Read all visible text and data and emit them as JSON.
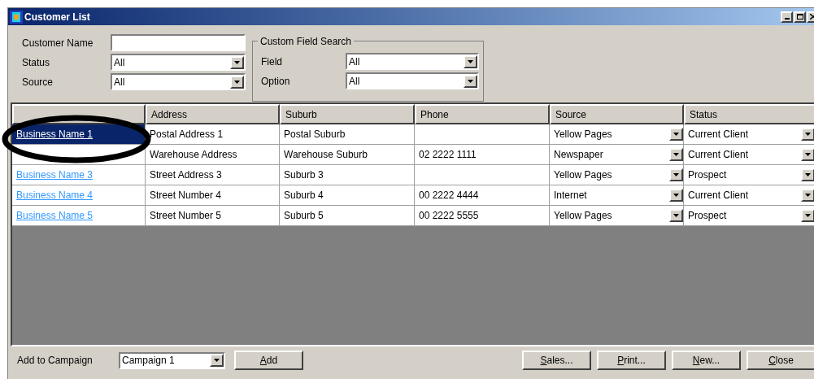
{
  "window": {
    "title": "Customer List"
  },
  "filters": [
    {
      "label": "Customer Name",
      "kind": "text"
    },
    {
      "label": "Status",
      "kind": "combo",
      "value": "All"
    },
    {
      "label": "Source",
      "kind": "combo",
      "value": "All"
    }
  ],
  "custom_field_search": {
    "title": "Custom Field Search",
    "fields": [
      {
        "label": "Field",
        "value": "All"
      },
      {
        "label": "Option",
        "value": "All"
      }
    ]
  },
  "table": {
    "columns": [
      null,
      "Address",
      "Suburb",
      "Phone",
      "Source",
      "Status"
    ],
    "rows": [
      {
        "selected": true,
        "name": "Business Name 1",
        "address": "Postal Address 1",
        "suburb": "Postal Suburb",
        "phone": "",
        "source": "Yellow Pages",
        "status": "Current Client"
      },
      {
        "selected": false,
        "address": "Warehouse Address",
        "suburb": "Warehouse Suburb",
        "phone": "02 2222 1111",
        "source": "Newspaper",
        "status": "Current Client"
      },
      {
        "selected": false,
        "name": "Business Name 3",
        "address": "Street Address 3",
        "suburb": "Suburb 3",
        "phone": "",
        "source": "Yellow Pages",
        "status": "Prospect"
      },
      {
        "selected": false,
        "name": "Business Name 4",
        "address": "Street Number 4",
        "suburb": "Suburb 4",
        "phone": "00 2222 4444",
        "source": "Internet",
        "status": "Current Client"
      },
      {
        "selected": false,
        "name": "Business Name 5",
        "address": "Street Number 5",
        "suburb": "Suburb 5",
        "phone": "00 2222 5555",
        "source": "Yellow Pages",
        "status": "Prospect"
      }
    ]
  },
  "bottom_bar": {
    "campaign_label": "Add to Campaign",
    "campaign": "Campaign 1",
    "buttons": [
      {
        "label": "Add"
      },
      {
        "label": "Sales..."
      },
      {
        "label": "Print..."
      },
      {
        "label": "New..."
      },
      {
        "label": "Close"
      }
    ]
  }
}
